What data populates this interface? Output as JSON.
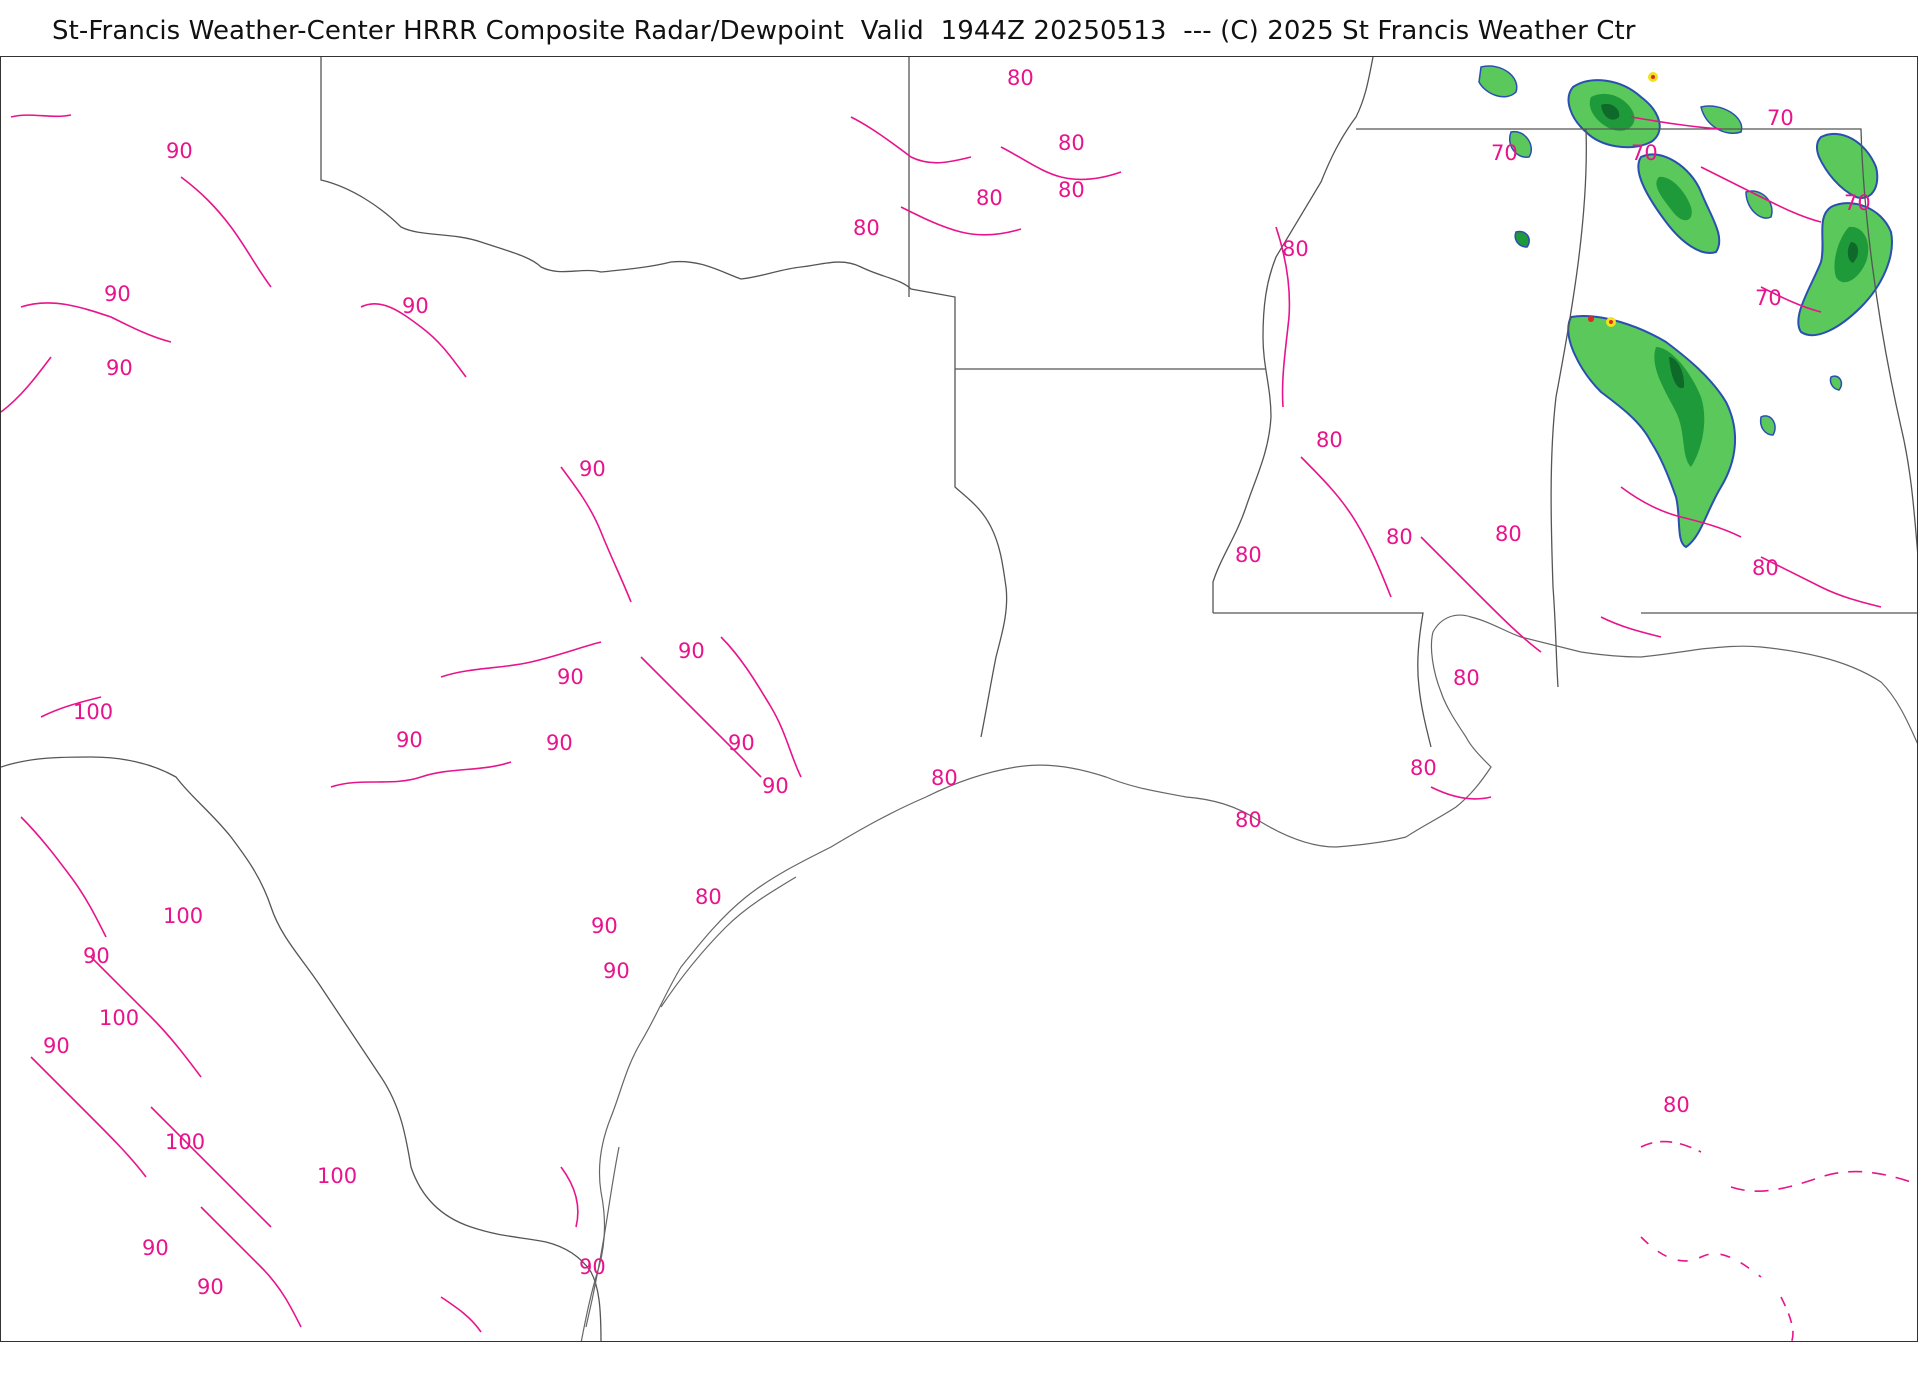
{
  "title": "St-Francis Weather-Center HRRR Composite Radar/Dewpoint  Valid  1944Z 20250513  --- (C) 2025 St Francis Weather Ctr",
  "colors": {
    "contour": "#e8148c",
    "boundary": "#555555",
    "radar_light": "#5ac85a",
    "radar_mid": "#1f9a3a",
    "radar_dark": "#0f6a2a",
    "radar_blue": "#2a4fb0",
    "radar_yellow": "#f2e21e",
    "radar_red": "#e02a1e"
  },
  "contour_labels": [
    "90",
    "90",
    "90",
    "90",
    "90",
    "90",
    "90",
    "90",
    "90",
    "90",
    "90",
    "90",
    "100",
    "100",
    "100",
    "100",
    "100",
    "90",
    "90",
    "90",
    "90",
    "90",
    "90",
    "80",
    "80",
    "80",
    "80",
    "80",
    "80",
    "80",
    "80",
    "80",
    "80",
    "80",
    "80",
    "80",
    "80",
    "80",
    "80",
    "80",
    "70",
    "70",
    "70",
    "70",
    "70"
  ],
  "icons": [
    "radar-echo-icon"
  ]
}
